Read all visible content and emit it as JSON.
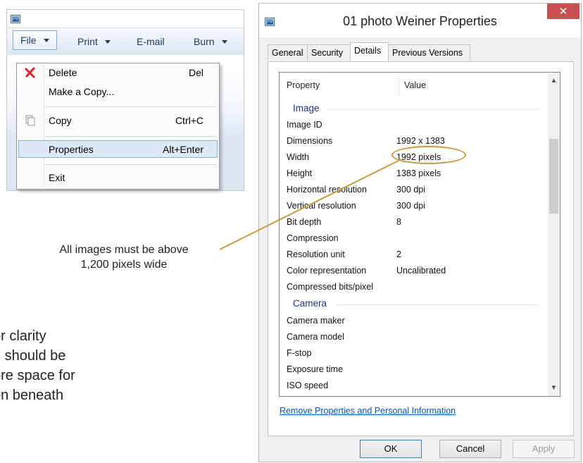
{
  "explorer": {
    "commands": [
      {
        "label": "File"
      },
      {
        "label": "Print"
      },
      {
        "label": "E-mail"
      },
      {
        "label": "Burn"
      }
    ],
    "menu": {
      "items": [
        {
          "label": "Delete",
          "shortcut": "Del",
          "icon": "delete-x-icon"
        },
        {
          "label": "Make a Copy...",
          "shortcut": ""
        },
        {
          "label": "Copy",
          "shortcut": "Ctrl+C",
          "icon": "copy-icon"
        },
        {
          "label": "Properties",
          "shortcut": "Alt+Enter",
          "selected": true
        },
        {
          "label": "Exit",
          "shortcut": ""
        }
      ]
    }
  },
  "dialog": {
    "title": "01 photo Weiner Properties",
    "close_label": "✕",
    "tabs": [
      "General",
      "Security",
      "Details",
      "Previous Versions"
    ],
    "active_tab": "Details",
    "columns": {
      "property": "Property",
      "value": "Value"
    },
    "groups": [
      {
        "title": "Image",
        "rows": [
          {
            "property": "Image ID",
            "value": ""
          },
          {
            "property": "Dimensions",
            "value": "1992 x 1383"
          },
          {
            "property": "Width",
            "value": "1992 pixels"
          },
          {
            "property": "Height",
            "value": "1383 pixels"
          },
          {
            "property": "Horizontal resolution",
            "value": "300 dpi"
          },
          {
            "property": "Vertical resolution",
            "value": "300 dpi"
          },
          {
            "property": "Bit depth",
            "value": "8"
          },
          {
            "property": "Compression",
            "value": ""
          },
          {
            "property": "Resolution unit",
            "value": "2"
          },
          {
            "property": "Color representation",
            "value": "Uncalibrated"
          },
          {
            "property": "Compressed bits/pixel",
            "value": ""
          }
        ]
      },
      {
        "title": "Camera",
        "rows": [
          {
            "property": "Camera maker",
            "value": ""
          },
          {
            "property": "Camera model",
            "value": ""
          },
          {
            "property": "F-stop",
            "value": ""
          },
          {
            "property": "Exposure time",
            "value": ""
          },
          {
            "property": "ISO speed",
            "value": ""
          }
        ]
      }
    ],
    "remove_link": "Remove Properties and Personal Information",
    "buttons": {
      "ok": "OK",
      "cancel": "Cancel",
      "apply": "Apply"
    }
  },
  "annotation": {
    "callout_line1": "All images must be above",
    "callout_line2": "1,200 pixels wide",
    "side_lines": [
      "or clarity",
      "n should be",
      "ore space for",
      "on beneath"
    ],
    "highlight_color": "#c99a45"
  }
}
